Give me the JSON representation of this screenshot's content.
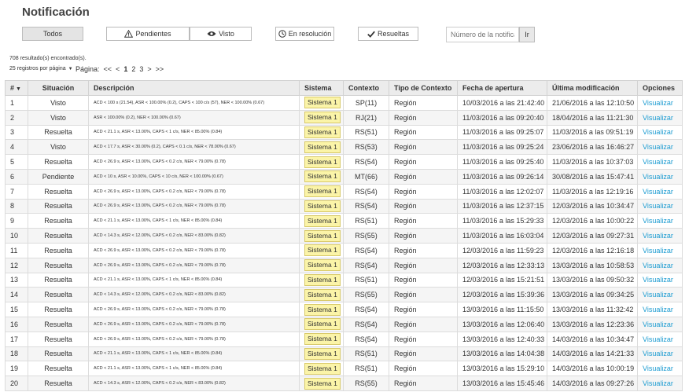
{
  "page": {
    "title": "Notificación"
  },
  "filters": [
    {
      "label": "Todos",
      "icon": "none",
      "active": true
    },
    {
      "label": "Pendientes",
      "icon": "warning-icon"
    },
    {
      "label": "Visto",
      "icon": "eye-icon"
    },
    {
      "label": "En resolución",
      "icon": "clock-icon"
    },
    {
      "label": "Resueltas",
      "icon": "check-icon"
    }
  ],
  "search": {
    "placeholder": "Número de la notificació",
    "button_label": "Ir"
  },
  "results": {
    "count_text": "708 resultado(s) encontrado(s).",
    "per_page_text": "25 registros por página",
    "pager_label": "Página:",
    "pager_first": "<<",
    "pager_prev": "<",
    "pages": [
      "1",
      "2",
      "3"
    ],
    "pager_next": ">",
    "pager_last": ">>"
  },
  "table": {
    "headers": [
      "#",
      "Situación",
      "Descripción",
      "Sistema",
      "Contexto",
      "Tipo de Contexto",
      "Fecha de apertura",
      "Última modificación",
      "Opciones"
    ],
    "rows": [
      [
        "1",
        "Visto",
        "ACD < 100 s (21.54), ASR < 100.00% (0.2), CAPS < 100 c/s (57), NER < 100.00% (0.67)",
        "Sistema 1",
        "SP(11)",
        "Región",
        "10/03/2016 a las 21:42:40",
        "21/06/2016 a las 12:10:50",
        "Visualizar"
      ],
      [
        "2",
        "Visto",
        "ASR < 100.00% (0.2), NER < 100.00% (0.67)",
        "Sistema 1",
        "RJ(21)",
        "Región",
        "11/03/2016 a las 09:20:40",
        "18/04/2016 a las 11:21:30",
        "Visualizar"
      ],
      [
        "3",
        "Resuelta",
        "ACD < 21.1 s, ASR < 13.00%, CAPS < 1 c/s, NER < 85.00% (0.84)",
        "Sistema 1",
        "RS(51)",
        "Región",
        "11/03/2016 a las 09:25:07",
        "11/03/2016 a las 09:51:19",
        "Visualizar"
      ],
      [
        "4",
        "Visto",
        "ACD < 17.7 s, ASR < 30.00% (0.2), CAPS < 0.1 c/s, NER < 78.00% (0.67)",
        "Sistema 1",
        "RS(53)",
        "Región",
        "11/03/2016 a las 09:25:24",
        "23/06/2016 a las 16:46:27",
        "Visualizar"
      ],
      [
        "5",
        "Resuelta",
        "ACD < 26.9 s, ASR < 13.00%, CAPS < 0.2 c/s, NER < 79.00% (0.78)",
        "Sistema 1",
        "RS(54)",
        "Región",
        "11/03/2016 a las 09:25:40",
        "11/03/2016 a las 10:37:03",
        "Visualizar"
      ],
      [
        "6",
        "Pendiente",
        "ACD < 10 s, ASR < 10.00%, CAPS < 10 c/s, NER < 100.00% (0.67)",
        "Sistema 1",
        "MT(66)",
        "Región",
        "11/03/2016 a las 09:26:14",
        "30/08/2016 a las 15:47:41",
        "Visualizar"
      ],
      [
        "7",
        "Resuelta",
        "ACD < 26.9 s, ASR < 13.00%, CAPS < 0.2 c/s, NER < 79.00% (0.78)",
        "Sistema 1",
        "RS(54)",
        "Región",
        "11/03/2016 a las 12:02:07",
        "11/03/2016 a las 12:19:16",
        "Visualizar"
      ],
      [
        "8",
        "Resuelta",
        "ACD < 26.9 s, ASR < 13.00%, CAPS < 0.2 c/s, NER < 79.00% (0.78)",
        "Sistema 1",
        "RS(54)",
        "Región",
        "11/03/2016 a las 12:37:15",
        "12/03/2016 a las 10:34:47",
        "Visualizar"
      ],
      [
        "9",
        "Resuelta",
        "ACD < 21.1 s, ASR < 13.00%, CAPS < 1 c/s, NER < 85.00% (0.84)",
        "Sistema 1",
        "RS(51)",
        "Región",
        "11/03/2016 a las 15:29:33",
        "12/03/2016 a las 10:00:22",
        "Visualizar"
      ],
      [
        "10",
        "Resuelta",
        "ACD < 14.3 s, ASR < 12.00%, CAPS < 0.2 c/s, NER < 83.00% (0.82)",
        "Sistema 1",
        "RS(55)",
        "Región",
        "11/03/2016 a las 16:03:04",
        "12/03/2016 a las 09:27:31",
        "Visualizar"
      ],
      [
        "11",
        "Resuelta",
        "ACD < 26.9 s, ASR < 13.00%, CAPS < 0.2 c/s, NER < 79.00% (0.78)",
        "Sistema 1",
        "RS(54)",
        "Región",
        "12/03/2016 a las 11:59:23",
        "12/03/2016 a las 12:16:18",
        "Visualizar"
      ],
      [
        "12",
        "Resuelta",
        "ACD < 26.9 s, ASR < 13.00%, CAPS < 0.2 c/s, NER < 79.00% (0.78)",
        "Sistema 1",
        "RS(54)",
        "Región",
        "12/03/2016 a las 12:33:13",
        "13/03/2016 a las 10:58:53",
        "Visualizar"
      ],
      [
        "13",
        "Resuelta",
        "ACD < 21.1 s, ASR < 13.00%, CAPS < 1 c/s, NER < 85.00% (0.84)",
        "Sistema 1",
        "RS(51)",
        "Región",
        "12/03/2016 a las 15:21:51",
        "13/03/2016 a las 09:50:32",
        "Visualizar"
      ],
      [
        "14",
        "Resuelta",
        "ACD < 14.3 s, ASR < 12.00%, CAPS < 0.2 c/s, NER < 83.00% (0.82)",
        "Sistema 1",
        "RS(55)",
        "Región",
        "12/03/2016 a las 15:39:36",
        "13/03/2016 a las 09:34:25",
        "Visualizar"
      ],
      [
        "15",
        "Resuelta",
        "ACD < 26.9 s, ASR < 13.00%, CAPS < 0.2 c/s, NER < 79.00% (0.78)",
        "Sistema 1",
        "RS(54)",
        "Región",
        "13/03/2016 a las 11:15:50",
        "13/03/2016 a las 11:32:42",
        "Visualizar"
      ],
      [
        "16",
        "Resuelta",
        "ACD < 26.9 s, ASR < 13.00%, CAPS < 0.2 c/s, NER < 79.00% (0.78)",
        "Sistema 1",
        "RS(54)",
        "Región",
        "13/03/2016 a las 12:06:40",
        "13/03/2016 a las 12:23:36",
        "Visualizar"
      ],
      [
        "17",
        "Resuelta",
        "ACD < 26.9 s, ASR < 13.00%, CAPS < 0.2 c/s, NER < 79.00% (0.78)",
        "Sistema 1",
        "RS(54)",
        "Región",
        "13/03/2016 a las 12:40:33",
        "14/03/2016 a las 10:34:47",
        "Visualizar"
      ],
      [
        "18",
        "Resuelta",
        "ACD < 21.1 s, ASR < 13.00%, CAPS < 1 c/s, NER < 85.00% (0.84)",
        "Sistema 1",
        "RS(51)",
        "Región",
        "13/03/2016 a las 14:04:38",
        "14/03/2016 a las 14:21:33",
        "Visualizar"
      ],
      [
        "19",
        "Resuelta",
        "ACD < 21.1 s, ASR < 13.00%, CAPS < 1 c/s, NER < 85.00% (0.84)",
        "Sistema 1",
        "RS(51)",
        "Región",
        "13/03/2016 a las 15:29:10",
        "14/03/2016 a las 10:00:19",
        "Visualizar"
      ],
      [
        "20",
        "Resuelta",
        "ACD < 14.3 s, ASR < 12.00%, CAPS < 0.2 c/s, NER < 83.00% (0.82)",
        "Sistema 1",
        "RS(55)",
        "Región",
        "13/03/2016 a las 15:45:46",
        "14/03/2016 a las 09:27:26",
        "Visualizar"
      ]
    ]
  }
}
